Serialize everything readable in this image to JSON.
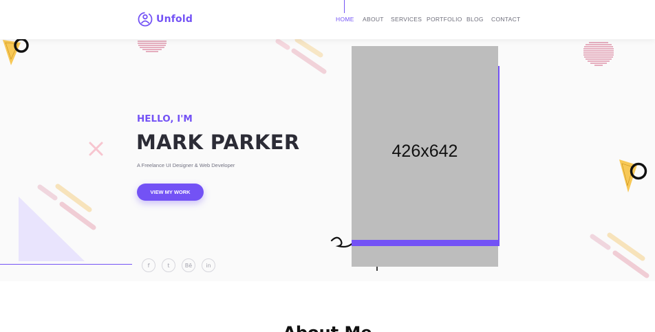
{
  "brand": {
    "name": "Unfold",
    "accent": "#7352f5"
  },
  "nav": {
    "items": [
      "HOME",
      "ABOUT",
      "SERVICES",
      "PORTFOLIO",
      "BLOG",
      "CONTACT"
    ],
    "active": "HOME"
  },
  "hero": {
    "greeting": "HELLO, I'M",
    "name": "MARK PARKER",
    "role": "A Freelance UI Designer & Web Developer",
    "cta_label": "VIEW MY WORK",
    "image_placeholder": "426x642",
    "socials": [
      {
        "icon": "facebook-icon",
        "glyph": "f"
      },
      {
        "icon": "twitter-icon",
        "glyph": "t"
      },
      {
        "icon": "behance-icon",
        "glyph": "Bē"
      },
      {
        "icon": "linkedin-icon",
        "glyph": "in"
      }
    ]
  },
  "about": {
    "title": "About Me"
  }
}
